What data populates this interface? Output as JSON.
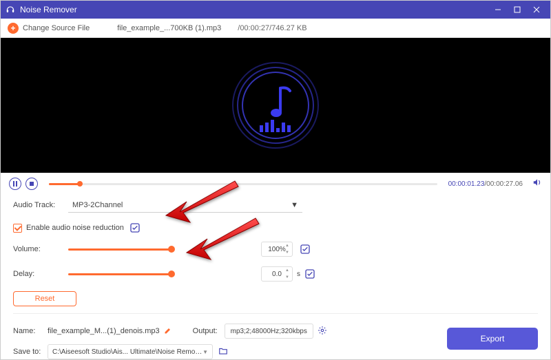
{
  "titlebar": {
    "title": "Noise Remover"
  },
  "header": {
    "change_label": "Change Source File",
    "filename": "file_example_...700KB (1).mp3",
    "meta": "/00:00:27/746.27 KB"
  },
  "player": {
    "current_time": "00:00:01.23",
    "total_time": "/00:00:27.06"
  },
  "settings": {
    "audio_track_label": "Audio Track:",
    "audio_track_value": "MP3-2Channel",
    "enable_label": "Enable audio noise reduction",
    "volume_label": "Volume:",
    "volume_value": "100%",
    "delay_label": "Delay:",
    "delay_value": "0.0",
    "delay_unit": "s",
    "reset_label": "Reset"
  },
  "footer": {
    "name_label": "Name:",
    "name_value": "file_example_M...(1)_denois.mp3",
    "output_label": "Output:",
    "output_value": "mp3;2;48000Hz;320kbps",
    "saveto_label": "Save to:",
    "saveto_value": "C:\\Aiseesoft Studio\\Ais... Ultimate\\Noise Remover",
    "export_label": "Export"
  }
}
